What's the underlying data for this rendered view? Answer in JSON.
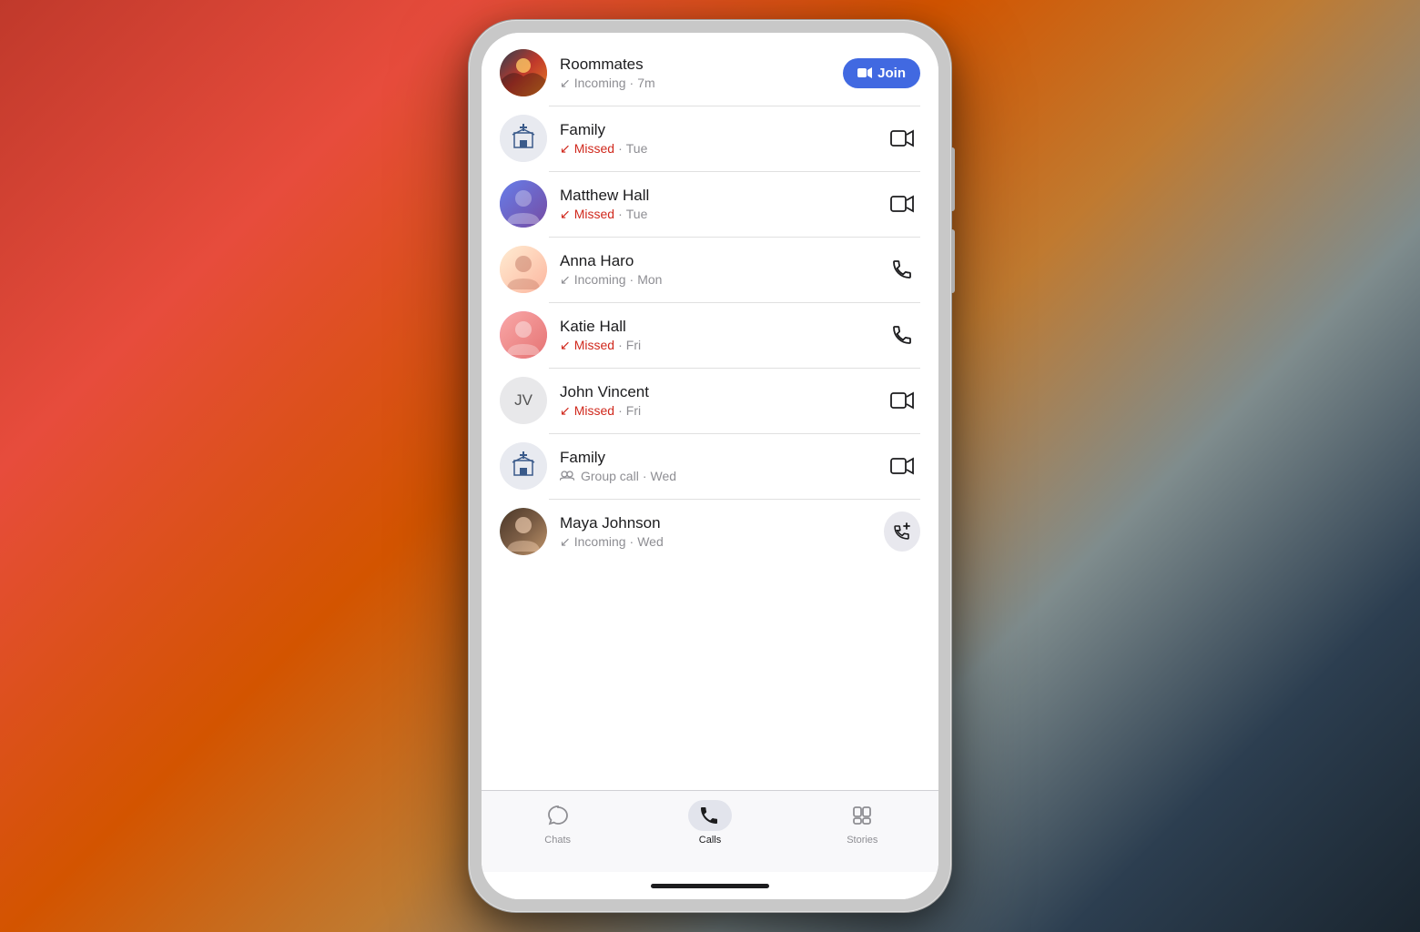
{
  "background": {
    "gradient": "orange-to-blue"
  },
  "calls": [
    {
      "id": "roommates",
      "name": "Roommates",
      "detail_type": "incoming",
      "detail_label": "Incoming",
      "time": "7m",
      "status": "incoming",
      "call_type": "video",
      "action": "join",
      "action_label": "Join"
    },
    {
      "id": "family1",
      "name": "Family",
      "detail_type": "missed",
      "detail_label": "Missed",
      "time": "Tue",
      "status": "missed",
      "call_type": "video",
      "action": "video"
    },
    {
      "id": "matthew",
      "name": "Matthew Hall",
      "detail_type": "missed",
      "detail_label": "Missed",
      "time": "Tue",
      "status": "missed",
      "call_type": "video",
      "action": "video"
    },
    {
      "id": "anna",
      "name": "Anna Haro",
      "detail_type": "incoming",
      "detail_label": "Incoming",
      "time": "Mon",
      "status": "incoming",
      "call_type": "phone",
      "action": "phone"
    },
    {
      "id": "katie",
      "name": "Katie Hall",
      "detail_type": "missed",
      "detail_label": "Missed",
      "time": "Fri",
      "status": "missed",
      "call_type": "phone",
      "action": "phone"
    },
    {
      "id": "john",
      "name": "John Vincent",
      "detail_type": "missed",
      "detail_label": "Missed",
      "time": "Fri",
      "status": "missed",
      "call_type": "video",
      "action": "video",
      "initials": "JV"
    },
    {
      "id": "family2",
      "name": "Family",
      "detail_type": "group",
      "detail_label": "Group call",
      "time": "Wed",
      "status": "group",
      "call_type": "video",
      "action": "video"
    },
    {
      "id": "maya",
      "name": "Maya Johnson",
      "detail_type": "incoming",
      "detail_label": "Incoming",
      "time": "Wed",
      "status": "incoming",
      "call_type": "phone",
      "action": "new-call"
    }
  ],
  "nav": {
    "items": [
      {
        "id": "chats",
        "label": "Chats",
        "active": false
      },
      {
        "id": "calls",
        "label": "Calls",
        "active": true
      },
      {
        "id": "stories",
        "label": "Stories",
        "active": false
      }
    ]
  },
  "join_label": "Join"
}
